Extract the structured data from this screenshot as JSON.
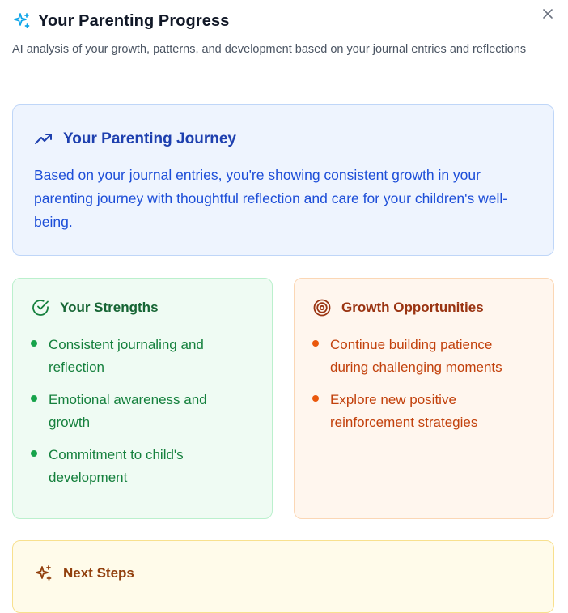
{
  "dialog": {
    "title": "Your Parenting Progress",
    "subtitle": "AI analysis of your growth, patterns, and development based on your journal entries and reflections",
    "title_icon": "sparkles-icon",
    "close_icon": "close-icon"
  },
  "journey": {
    "title": "Your Parenting Journey",
    "icon": "trending-up-icon",
    "text": "Based on your journal entries, you're showing consistent growth in your parenting journey with thoughtful reflection and care for your children's well-being."
  },
  "strengths": {
    "title": "Your Strengths",
    "icon": "check-circle-icon",
    "items": [
      "Consistent journaling and reflection",
      "Emotional awareness and growth",
      "Commitment to child's development"
    ]
  },
  "growth": {
    "title": "Growth Opportunities",
    "icon": "target-icon",
    "items": [
      "Continue building patience during challenging moments",
      "Explore new positive reinforcement strategies"
    ]
  },
  "next_steps": {
    "title": "Next Steps",
    "icon": "sparkles-icon"
  },
  "colors": {
    "accent_blue": "#1d4ed8",
    "strength_green": "#16a34a",
    "growth_orange": "#ea580c",
    "next_amber": "#92400e"
  }
}
